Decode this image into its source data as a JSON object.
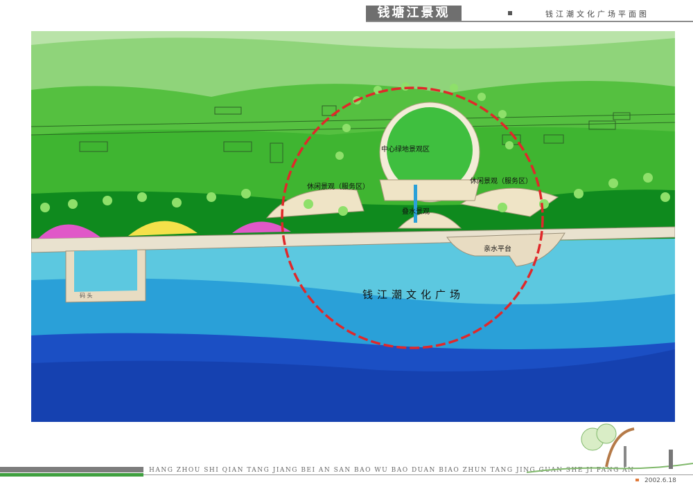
{
  "header": {
    "title": "钱塘江景观",
    "subtitle": "钱江潮文化广场平面图"
  },
  "map": {
    "labels": {
      "central_green": "中心绿地景观区",
      "leisure_left": "休闲景观（服务区）",
      "leisure_right": "休闲景观（服务区）",
      "cascade": "叠水景观",
      "waterside_platform": "亲水平台",
      "plaza": "钱江潮文化广场",
      "pier": "码    头"
    },
    "colors": {
      "focus_circle": "#e0282a",
      "land_green": "#3fbf3f",
      "river_blue": "#1b4fc4",
      "shore_cyan": "#5cc8e0"
    }
  },
  "footer": {
    "caption": "HANG ZHOU SHI QIAN TANG JIANG BEI AN SAN BAO WU BAO DUAN BIAO ZHUN TANG JING GUAN SHE JI FANG AN",
    "date": "2002.6.18"
  }
}
